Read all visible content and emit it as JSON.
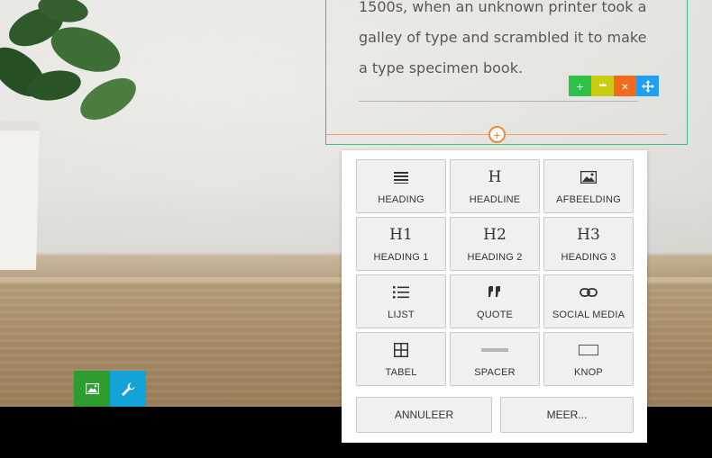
{
  "editor_text": {
    "lines": [
      "1500s, when an unknown printer took a",
      "galley of type and scrambled it to make",
      "a type specimen book."
    ]
  },
  "block_toolbar": {
    "add_icon": "plus-icon",
    "more_icon": "ellipsis-icon",
    "delete_icon": "close-icon",
    "move_icon": "move-arrows-icon",
    "colors": {
      "add": "#2ec24a",
      "more": "#c9cc12",
      "delete": "#f26b1d",
      "move": "#1e9ff2"
    }
  },
  "insert_button": {
    "icon": "plus-icon",
    "glyph": "+"
  },
  "panel": {
    "tiles": [
      {
        "label": "HEADING",
        "icon": "lines-icon"
      },
      {
        "label": "HEADLINE",
        "icon": "H"
      },
      {
        "label": "AFBEELDING",
        "icon": "image-icon"
      },
      {
        "label": "HEADING 1",
        "icon": "H1"
      },
      {
        "label": "HEADING 2",
        "icon": "H2"
      },
      {
        "label": "HEADING 3",
        "icon": "H3"
      },
      {
        "label": "LIJST",
        "icon": "list-icon"
      },
      {
        "label": "QUOTE",
        "icon": "quote-icon"
      },
      {
        "label": "SOCIAL MEDIA",
        "icon": "link-icon"
      },
      {
        "label": "TABEL",
        "icon": "table-icon"
      },
      {
        "label": "SPACER",
        "icon": "spacer-icon"
      },
      {
        "label": "KNOP",
        "icon": "button-icon"
      }
    ],
    "cancel_label": "ANNULEER",
    "more_label": "MEER..."
  },
  "image_tools": {
    "image_icon": "image-icon",
    "wrench_icon": "wrench-icon",
    "colors": {
      "image": "#2f9c2f",
      "wrench": "#14a3d8"
    }
  }
}
